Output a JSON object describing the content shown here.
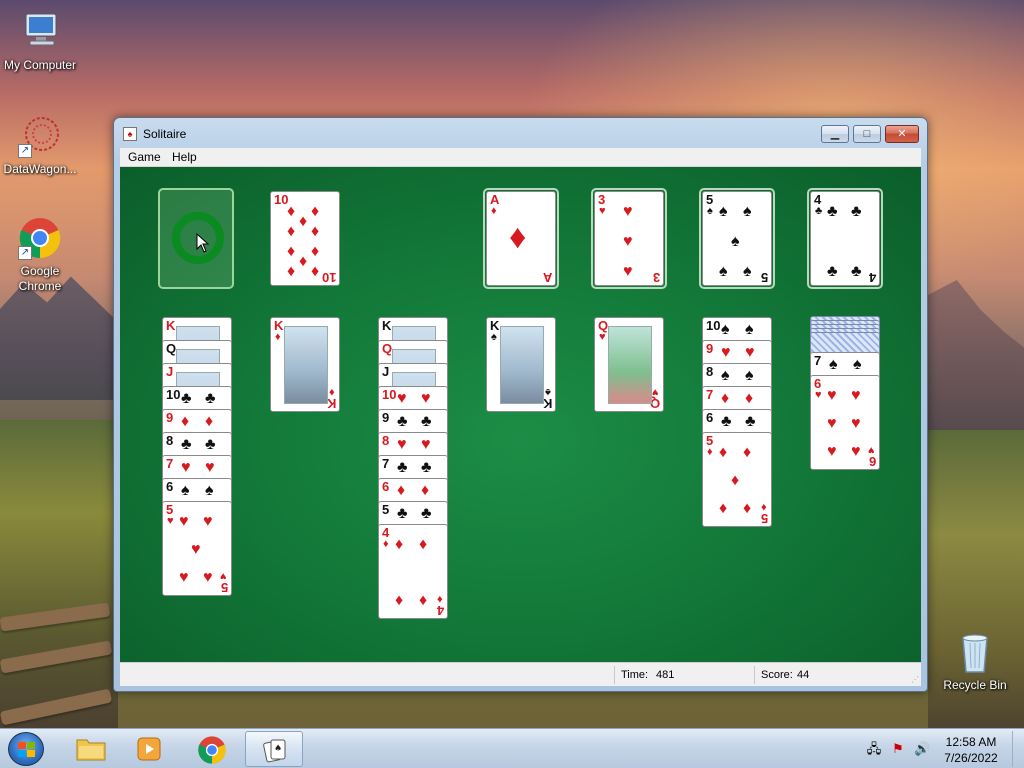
{
  "desktop": {
    "icons": [
      {
        "label": "My Computer",
        "icon": "computer-icon"
      },
      {
        "label": "DataWagon...",
        "icon": "datawagon-icon"
      },
      {
        "label": "Google\nChrome",
        "icon": "chrome-icon"
      },
      {
        "label": "Recycle Bin",
        "icon": "recycle-bin-icon"
      }
    ]
  },
  "window": {
    "title": "Solitaire",
    "menu": [
      "Game",
      "Help"
    ],
    "status": {
      "time_label": "Time:",
      "time_value": "481",
      "score_label": "Score:",
      "score_value": "44"
    }
  },
  "game": {
    "waste": {
      "rank": "10",
      "suit": "♦"
    },
    "foundations": [
      {
        "rank": "A",
        "suit": "♦"
      },
      {
        "rank": "3",
        "suit": "♥"
      },
      {
        "rank": "5",
        "suit": "♠"
      },
      {
        "rank": "4",
        "suit": "♣"
      }
    ],
    "tableau": [
      {
        "cards": [
          "K",
          "Q",
          "J",
          "10♣",
          "9♦",
          "8♣",
          "7♥",
          "6♠"
        ],
        "top": {
          "rank": "5",
          "suit": "♥"
        }
      },
      {
        "cards": [],
        "top": {
          "rank": "K",
          "suit": "♦"
        }
      },
      {
        "cards": [
          "K",
          "Q",
          "J",
          "10♥",
          "9♣",
          "8♥",
          "7♣",
          "6♦",
          "5♣"
        ],
        "top": {
          "rank": "4",
          "suit": "♦"
        }
      },
      {
        "cards": [],
        "top": {
          "rank": "K",
          "suit": "♠"
        }
      },
      {
        "cards": [],
        "top": {
          "rank": "Q",
          "suit": "♥"
        }
      },
      {
        "cards": [
          "10♠",
          "9♥",
          "8♠",
          "7♦",
          "6♣"
        ],
        "top": {
          "rank": "5",
          "suit": "♦"
        }
      },
      {
        "cards": [
          "7♠"
        ],
        "top": {
          "rank": "6",
          "suit": "♥"
        }
      }
    ]
  },
  "taskbar": {
    "time": "12:58 AM",
    "date": "7/26/2022"
  },
  "colors": {
    "felt": "#137a3a",
    "red_suit": "#d71920",
    "black_suit": "#111111"
  }
}
